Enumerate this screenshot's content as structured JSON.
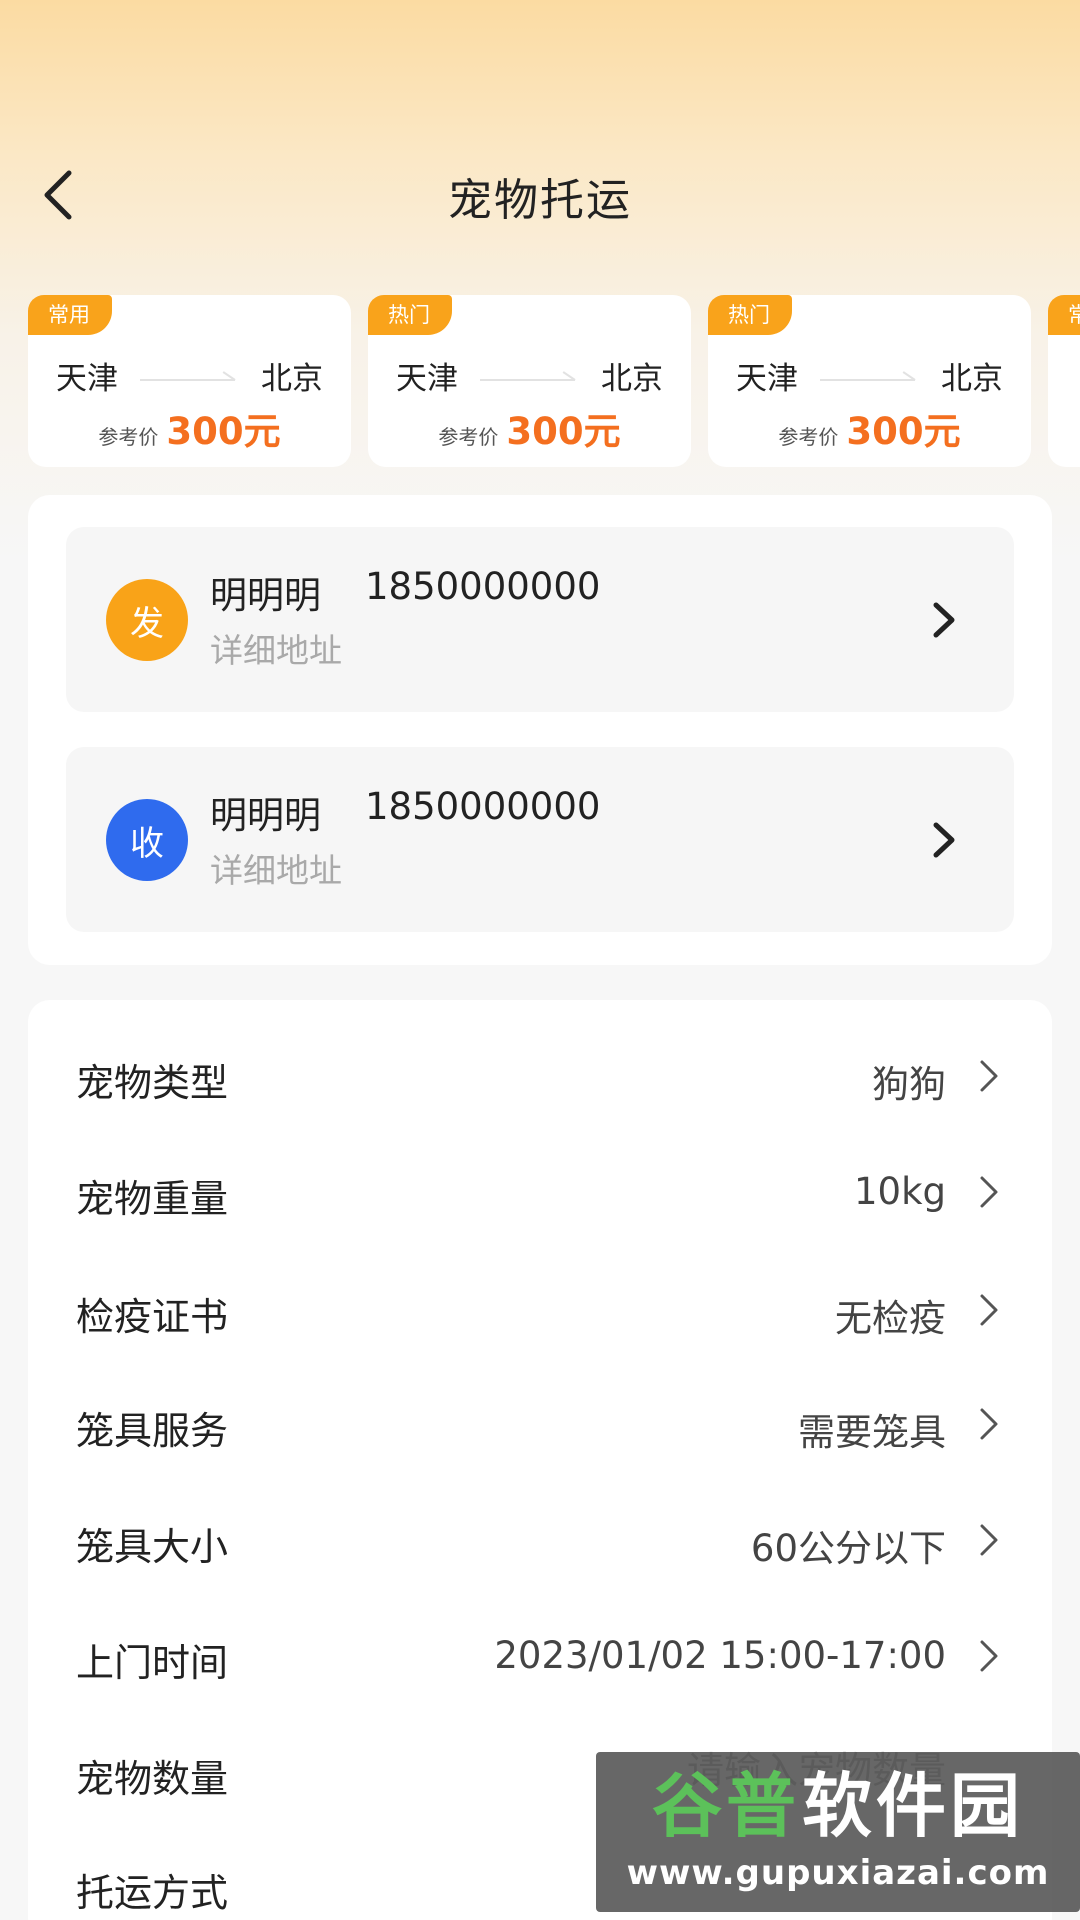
{
  "header": {
    "title": "宠物托运"
  },
  "routes": [
    {
      "tag": "常用",
      "from": "天津",
      "to": "北京",
      "price_label": "参考价",
      "price": "300元"
    },
    {
      "tag": "热门",
      "from": "天津",
      "to": "北京",
      "price_label": "参考价",
      "price": "300元"
    },
    {
      "tag": "热门",
      "from": "天津",
      "to": "北京",
      "price_label": "参考价",
      "price": "300元"
    },
    {
      "tag": "常",
      "from": "",
      "to": "",
      "price_label": "",
      "price": ""
    }
  ],
  "contacts": {
    "sender": {
      "badge": "发",
      "name": "明明明",
      "phone": "1850000000",
      "address": "详细地址"
    },
    "receiver": {
      "badge": "收",
      "name": "明明明",
      "phone": "1850000000",
      "address": "详细地址"
    }
  },
  "form": {
    "pet_type": {
      "label": "宠物类型",
      "value": "狗狗"
    },
    "pet_weight": {
      "label": "宠物重量",
      "value": "10kg"
    },
    "quarantine": {
      "label": "检疫证书",
      "value": "无检疫"
    },
    "cage_service": {
      "label": "笼具服务",
      "value": "需要笼具"
    },
    "cage_size": {
      "label": "笼具大小",
      "value": "60公分以下"
    },
    "pickup_time": {
      "label": "上门时间",
      "value": "2023/01/02 15:00-17:00"
    },
    "pet_count": {
      "label": "宠物数量",
      "placeholder": "请输入宠物数量"
    },
    "shipping_method": {
      "label": "托运方式"
    }
  },
  "watermark": {
    "brand_green": "谷普",
    "brand_white": "软件园",
    "url": "www.gupuxiazai.com"
  },
  "colors": {
    "accent_orange": "#f9a31b",
    "price_orange": "#f46f1f",
    "receiver_blue": "#2f6bee"
  }
}
